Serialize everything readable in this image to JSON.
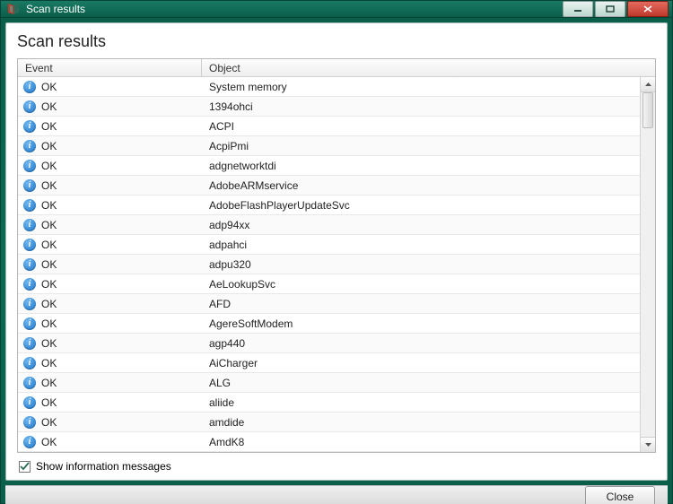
{
  "window": {
    "title": "Scan results"
  },
  "page": {
    "heading": "Scan results"
  },
  "table": {
    "columns": {
      "event": "Event",
      "object": "Object"
    },
    "rows": [
      {
        "event": "OK",
        "object": "System memory"
      },
      {
        "event": "OK",
        "object": "1394ohci"
      },
      {
        "event": "OK",
        "object": "ACPI"
      },
      {
        "event": "OK",
        "object": "AcpiPmi"
      },
      {
        "event": "OK",
        "object": "adgnetworktdi"
      },
      {
        "event": "OK",
        "object": "AdobeARMservice"
      },
      {
        "event": "OK",
        "object": "AdobeFlashPlayerUpdateSvc"
      },
      {
        "event": "OK",
        "object": "adp94xx"
      },
      {
        "event": "OK",
        "object": "adpahci"
      },
      {
        "event": "OK",
        "object": "adpu320"
      },
      {
        "event": "OK",
        "object": "AeLookupSvc"
      },
      {
        "event": "OK",
        "object": "AFD"
      },
      {
        "event": "OK",
        "object": "AgereSoftModem"
      },
      {
        "event": "OK",
        "object": "agp440"
      },
      {
        "event": "OK",
        "object": "AiCharger"
      },
      {
        "event": "OK",
        "object": "ALG"
      },
      {
        "event": "OK",
        "object": "aliide"
      },
      {
        "event": "OK",
        "object": "amdide"
      },
      {
        "event": "OK",
        "object": "AmdK8"
      }
    ]
  },
  "options": {
    "show_info_label": "Show information messages",
    "show_info_checked": true
  },
  "buttons": {
    "close": "Close"
  }
}
